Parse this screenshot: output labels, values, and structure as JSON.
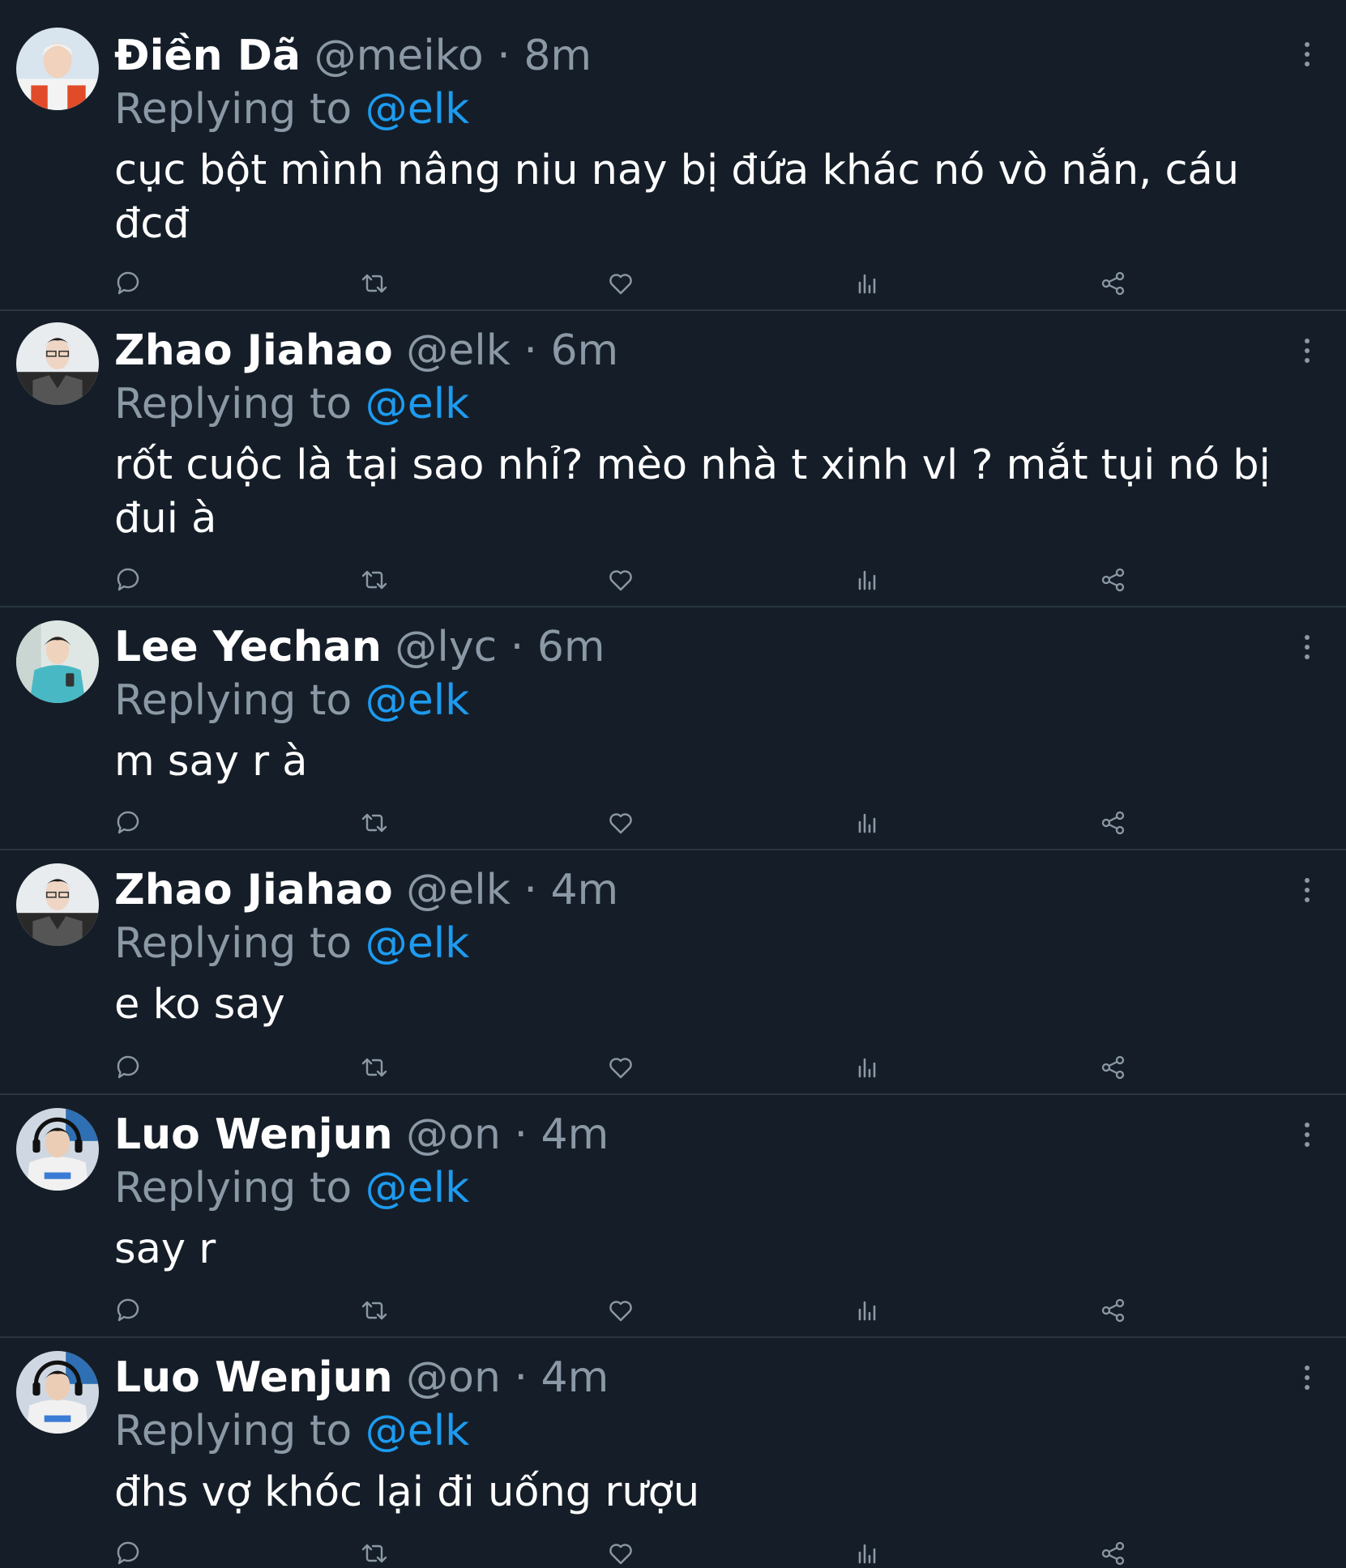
{
  "reply_prefix": "Replying to",
  "icons": {
    "more": "more-vertical-icon",
    "reply": "reply-bubble-icon",
    "retweet": "retweet-icon",
    "like": "heart-icon",
    "views": "analytics-bars-icon",
    "share": "share-icon"
  },
  "colors": {
    "background": "#151e28",
    "divider": "#2a3542",
    "muted_text": "#8b98a5",
    "link": "#1d9bf0",
    "primary_text": "#ffffff"
  },
  "tweets": [
    {
      "name": "Điền Dã",
      "handle": "@meiko",
      "time": "8m",
      "replying_to": "@elk",
      "text": "cục bột mình nâng niu nay bị đứa khác nó vò nắn, cáu đcđ"
    },
    {
      "name": "Zhao Jiahao",
      "handle": "@elk",
      "time": "6m",
      "replying_to": "@elk",
      "text": "rốt cuộc là tại sao nhỉ? mèo nhà t xinh vl ? mắt tụi nó bị đui à"
    },
    {
      "name": "Lee Yechan",
      "handle": "@lyc",
      "time": "6m",
      "replying_to": "@elk",
      "text": "m say r à"
    },
    {
      "name": "Zhao Jiahao",
      "handle": "@elk",
      "time": "4m",
      "replying_to": "@elk",
      "text": "e ko say"
    },
    {
      "name": "Luo Wenjun",
      "handle": "@on",
      "time": "4m",
      "replying_to": "@elk",
      "text": "say r"
    },
    {
      "name": "Luo Wenjun",
      "handle": "@on",
      "time": "4m",
      "replying_to": "@elk",
      "text": "đhs vợ khóc lại đi uống rượu"
    }
  ]
}
